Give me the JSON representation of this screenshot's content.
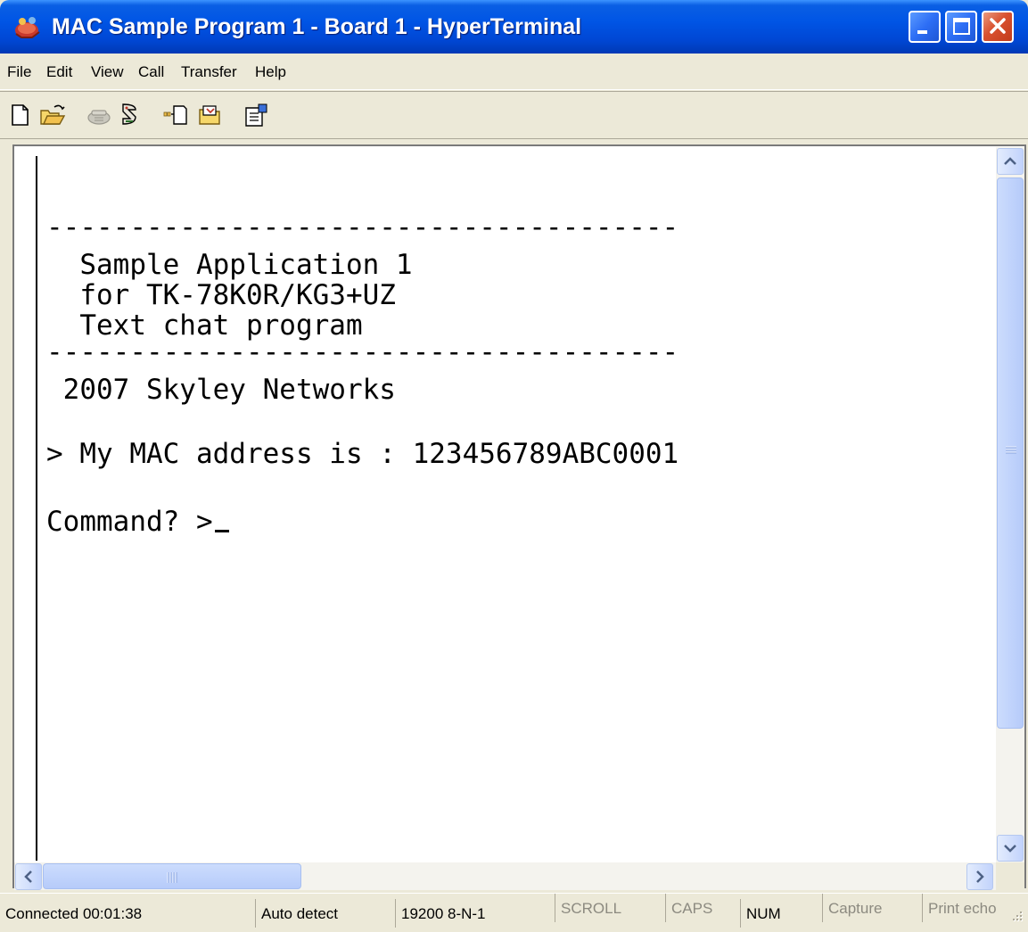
{
  "window": {
    "title": "MAC Sample Program 1 - Board 1 - HyperTerminal"
  },
  "menu": [
    {
      "label": "File"
    },
    {
      "label": "Edit"
    },
    {
      "label": "View"
    },
    {
      "label": "Call"
    },
    {
      "label": "Transfer"
    },
    {
      "label": "Help"
    }
  ],
  "toolbar": {
    "icons": [
      "new-file-icon",
      "open-folder-icon",
      "connect-phone-icon",
      "disconnect-phone-icon",
      "send-file-icon",
      "receive-file-icon",
      "properties-icon"
    ]
  },
  "terminal": {
    "lines": [
      "--------------------------------------",
      "  Sample Application 1",
      "  for TK-78K0R/KG3+UZ",
      "  Text chat program",
      "--------------------------------------",
      " 2007 Skyley Networks",
      "> My MAC address is : 123456789ABC0001",
      "Command? >"
    ]
  },
  "statusbar": {
    "connected": "Connected 00:01:38",
    "detect": "Auto detect",
    "settings": "19200 8-N-1",
    "scroll": "SCROLL",
    "caps": "CAPS",
    "num": "NUM",
    "capture": "Capture",
    "print_echo": "Print echo"
  },
  "colors": {
    "titlebar": "#0055e5",
    "close_button": "#d9512f",
    "terminal_bg": "#ffffff",
    "chrome": "#ece9d8"
  }
}
